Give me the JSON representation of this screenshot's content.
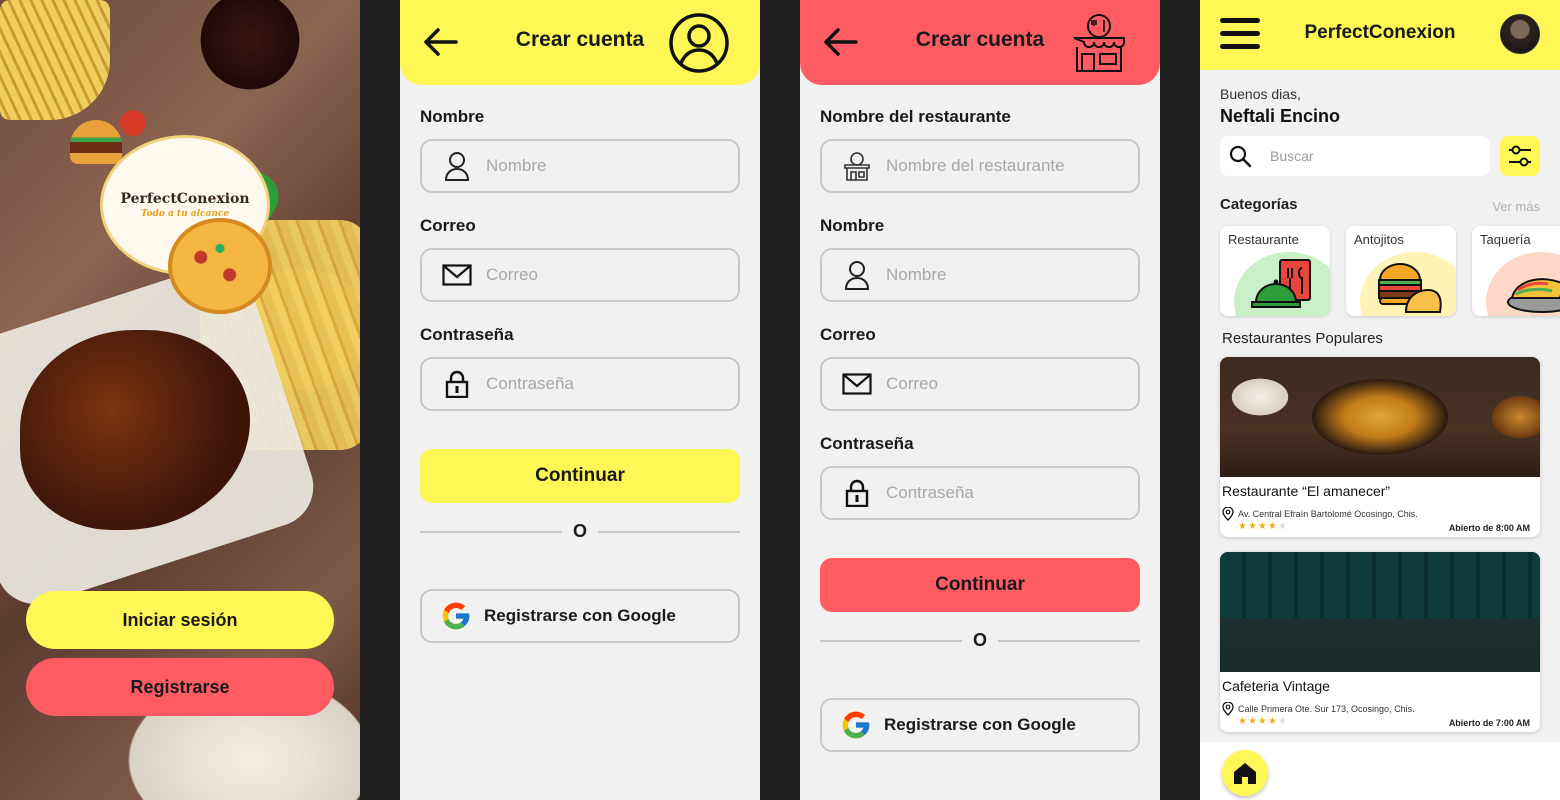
{
  "welcome": {
    "logo_title": "PerfectConexion",
    "logo_tagline": "Todo a tu alcance",
    "login_label": "Iniciar sesión",
    "register_label": "Registrarse",
    "colors": {
      "yellow": "#fff755",
      "red": "#ff5b63"
    }
  },
  "user_signup": {
    "title": "Crear cuenta",
    "header_icon": "user-circle-icon",
    "fields": [
      {
        "label": "Nombre",
        "placeholder": "Nombre",
        "icon": "person-icon"
      },
      {
        "label": "Correo",
        "placeholder": "Correo",
        "icon": "mail-icon"
      },
      {
        "label": "Contraseña",
        "placeholder": "Contraseña",
        "icon": "lock-icon"
      }
    ],
    "continue_label": "Continuar",
    "divider": "O",
    "google_label": "Registrarse con Google"
  },
  "restaurant_signup": {
    "title": "Crear cuenta",
    "header_icon": "storefront-icon",
    "fields": [
      {
        "label": "Nombre del restaurante",
        "placeholder": "Nombre del restaurante",
        "icon": "restaurant-icon"
      },
      {
        "label": "Nombre",
        "placeholder": "Nombre",
        "icon": "person-icon"
      },
      {
        "label": "Correo",
        "placeholder": "Correo",
        "icon": "mail-icon"
      },
      {
        "label": "Contraseña",
        "placeholder": "Contraseña",
        "icon": "lock-icon"
      }
    ],
    "continue_label": "Continuar",
    "divider": "O",
    "google_label": "Registrarse con Google"
  },
  "home": {
    "app_title": "PerfectConexion",
    "greeting": "Buenos dias,",
    "user_name": "Neftali Encino",
    "search_placeholder": "Buscar",
    "categories_title": "Categorías",
    "see_more": "Ver más",
    "categories": [
      {
        "label": "Restaurante",
        "color": "#c9f0c6",
        "icon": "menu-cloche-icon"
      },
      {
        "label": "Antojitos",
        "color": "#fdf3b5",
        "icon": "burger-empanada-icon"
      },
      {
        "label": "Taquería",
        "color": "#ffd7c7",
        "icon": "taco-icon"
      }
    ],
    "popular_title": "Restaurantes Populares",
    "restaurants": [
      {
        "name": "Restaurante “El amanecer”",
        "address": "Av. Central Efraín Bartolomé Ocosingo, Chis.",
        "rating": 4,
        "hours": "Abierto de 8:00 AM"
      },
      {
        "name": "Cafeteria Vintage",
        "address": "Calle Primera Ote. Sur 173, Ocosingo, Chis.",
        "rating": 4,
        "hours": "Abierto de 7:00 AM"
      }
    ]
  }
}
